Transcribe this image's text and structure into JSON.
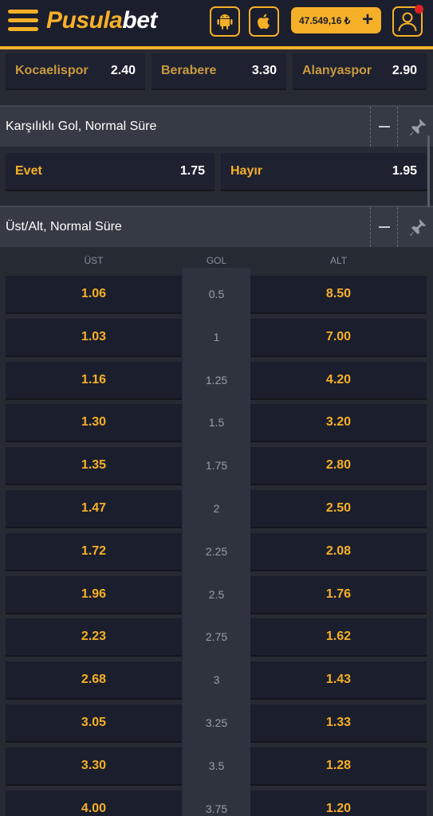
{
  "header": {
    "logo_part1": "Pusula",
    "logo_part2": "bet",
    "balance": "47.549,16 ₺",
    "balance_plus": "+"
  },
  "match_result": [
    {
      "name": "Kocaelispor",
      "odd": "2.40"
    },
    {
      "name": "Berabere",
      "odd": "3.30"
    },
    {
      "name": "Alanyaspor",
      "odd": "2.90"
    }
  ],
  "btts": {
    "title": "Karşılıklı Gol, Normal Süre",
    "options": [
      {
        "name": "Evet",
        "odd": "1.75"
      },
      {
        "name": "Hayır",
        "odd": "1.95"
      }
    ]
  },
  "over_under": {
    "title": "Üst/Alt, Normal Süre",
    "col_over": "ÜST",
    "col_line": "GOL",
    "col_under": "ALT",
    "rows": [
      {
        "over": "1.06",
        "line": "0.5",
        "under": "8.50"
      },
      {
        "over": "1.03",
        "line": "1",
        "under": "7.00"
      },
      {
        "over": "1.16",
        "line": "1.25",
        "under": "4.20"
      },
      {
        "over": "1.30",
        "line": "1.5",
        "under": "3.20"
      },
      {
        "over": "1.35",
        "line": "1.75",
        "under": "2.80"
      },
      {
        "over": "1.47",
        "line": "2",
        "under": "2.50"
      },
      {
        "over": "1.72",
        "line": "2.25",
        "under": "2.08"
      },
      {
        "over": "1.96",
        "line": "2.5",
        "under": "1.76"
      },
      {
        "over": "2.23",
        "line": "2.75",
        "under": "1.62"
      },
      {
        "over": "2.68",
        "line": "3",
        "under": "1.43"
      },
      {
        "over": "3.05",
        "line": "3.25",
        "under": "1.33"
      },
      {
        "over": "3.30",
        "line": "3.5",
        "under": "1.28"
      },
      {
        "over": "4.00",
        "line": "3.75",
        "under": "1.20"
      }
    ]
  },
  "colors": {
    "accent": "#f6b028",
    "header_bg": "#1b1e2c",
    "page_bg": "#262a33",
    "notification": "#e02020"
  },
  "icons": [
    "menu-icon",
    "android-icon",
    "apple-icon",
    "plus-icon",
    "user-icon",
    "minus-icon",
    "pin-icon"
  ]
}
